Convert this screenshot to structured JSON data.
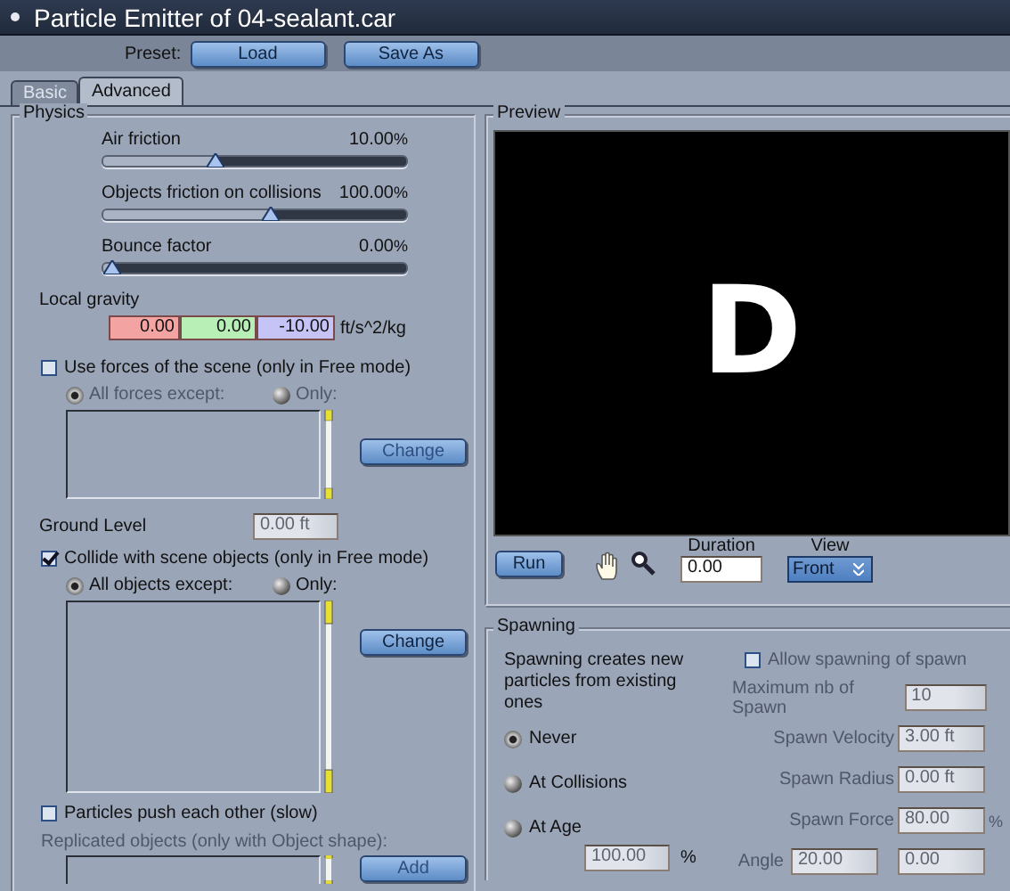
{
  "window": {
    "title": "Particle Emitter of 04-sealant.car"
  },
  "preset": {
    "label": "Preset:",
    "buttons": [
      "Load",
      "Save As"
    ]
  },
  "tabs": [
    {
      "label": "Basic",
      "selected": false
    },
    {
      "label": "Advanced",
      "selected": true
    }
  ],
  "physics": {
    "title": "Physics",
    "sliders": [
      {
        "label": "Air friction",
        "reading": "10.00",
        "unit": "%",
        "level": 0.37
      },
      {
        "label": "Objects friction on collisions",
        "reading": "100.00",
        "unit": "%",
        "level": 0.55
      },
      {
        "label": "Bounce factor",
        "reading": "0.00",
        "unit": "%",
        "level": 0.03
      }
    ],
    "gravity": {
      "label": "Local gravity",
      "values": [
        "0.00",
        "0.00",
        "-10.00"
      ],
      "unit": "ft/s^2/kg"
    },
    "use_forces": {
      "label": "Use forces of the scene (only in Free mode)",
      "checked": false,
      "disabled": true,
      "radios": [
        {
          "label": "All forces except:",
          "selected": true
        },
        {
          "label": "Only:",
          "selected": false
        }
      ],
      "button": "Change"
    },
    "ground_level": {
      "label": "Ground Level",
      "value": "0.00 ft",
      "disabled": true
    },
    "collide": {
      "label": "Collide with scene objects (only in Free mode)",
      "checked": true,
      "disabled": false,
      "radios": [
        {
          "label": "All objects except:",
          "selected": true
        },
        {
          "label": "Only:",
          "selected": false
        }
      ],
      "button": "Change"
    },
    "push": {
      "label": "Particles push each other (slow)",
      "checked": false
    },
    "replicated": {
      "label": "Replicated objects (only with Object shape):",
      "disabled": true,
      "button": "Add"
    }
  },
  "preview": {
    "title": "Preview",
    "display": "D",
    "run": "Run",
    "duration": {
      "label": "Duration",
      "value": "0.00"
    },
    "view": {
      "label": "View",
      "value": "Front"
    }
  },
  "spawning": {
    "title": "Spawning",
    "description": "Spawning creates new particles from existing ones",
    "modes": [
      {
        "label": "Never",
        "selected": true
      },
      {
        "label": "At Collisions",
        "selected": false
      },
      {
        "label": "At Age",
        "selected": false
      }
    ],
    "age": {
      "value": "100.00",
      "unit": "%"
    },
    "allow": {
      "label": "Allow spawning of spawn",
      "checked": false
    },
    "disabled": true,
    "fields": [
      {
        "label": "Maximum nb of Spawn",
        "value": "10"
      },
      {
        "label": "Spawn Velocity",
        "value": "3.00 ft"
      },
      {
        "label": "Spawn Radius",
        "value": "0.00 ft"
      },
      {
        "label": "Spawn Force",
        "value": "80.00",
        "unit": "%"
      }
    ],
    "angle": {
      "label": "Angle",
      "values": [
        "20.00",
        "0.00"
      ]
    }
  }
}
